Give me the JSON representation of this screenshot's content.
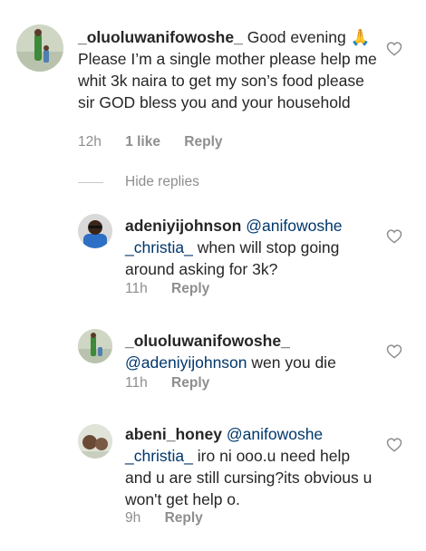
{
  "comments": [
    {
      "username": "_oluoluwanifowoshe_",
      "text": "Good evening 🙏 Please I’m a single mother please help me whit 3k naira to get my son’s food please sir GOD bless you and your household",
      "time": "12h",
      "likes": "1 like",
      "reply": "Reply",
      "avatar_icon": "avatar-photo"
    },
    {
      "username": "adeniyijohnson",
      "mention": "@anifowoshe _christia_",
      "text": "when will stop going around asking for 3k?",
      "time": "11h",
      "reply": "Reply",
      "avatar_icon": "avatar-photo"
    },
    {
      "username": "_oluoluwanifowoshe_",
      "mention": "@adeniyijohnson",
      "text": "wen you die",
      "time": "11h",
      "reply": "Reply",
      "avatar_icon": "avatar-photo"
    },
    {
      "username": "abeni_honey",
      "mention": "@anifowoshe _christia_",
      "text": "iro ni ooo.u need help and u are still cursing?its obvious u won't get help o.",
      "time": "9h",
      "reply": "Reply",
      "avatar_icon": "avatar-photo"
    }
  ],
  "hide_replies_label": "Hide replies",
  "icons": {
    "like": "heart-outline-icon"
  },
  "colors": {
    "text": "#262626",
    "meta": "#8e8e8e",
    "mention": "#00376b"
  }
}
